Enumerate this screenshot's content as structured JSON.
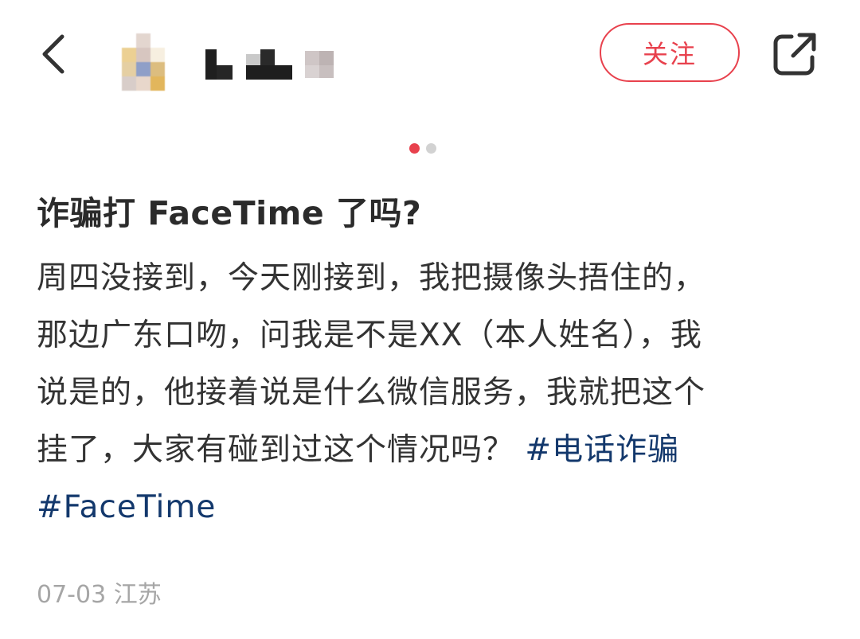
{
  "header": {
    "follow_label": "关注"
  },
  "pager": {
    "total": 2,
    "active_index": 0,
    "active_color": "#e8414d",
    "inactive_color": "#d2d2d2"
  },
  "post": {
    "title": "诈骗打 FaceTime 了吗?",
    "body_lines": [
      "周四没接到，今天刚接到，我把摄像头捂住的，",
      "那边广东口吻，问我是不是XX（本人姓名），我",
      "说是的，他接着说是什么微信服务，我就把这个"
    ],
    "body_last_line": "挂了，大家有碰到过这个情况吗？",
    "hashtags": [
      "#电话诈骗",
      "#FaceTime"
    ],
    "date": "07-03",
    "location": "江苏"
  },
  "colors": {
    "accent": "#e8414d",
    "hashtag": "#13386c",
    "meta": "#a6a6a6"
  },
  "icons": {
    "back": "chevron-left-icon",
    "share": "share-icon"
  }
}
